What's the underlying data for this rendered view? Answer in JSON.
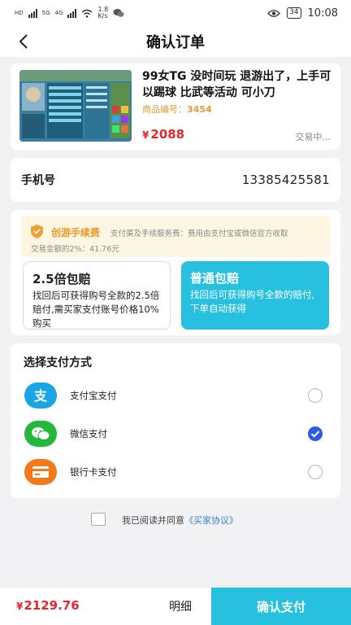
{
  "status_bar": {
    "network_left": "HD",
    "network_5g": "5G",
    "network_4g": "4G",
    "speed_value": "1.8",
    "speed_unit": "K/s",
    "battery": "34",
    "time": "10:08"
  },
  "header": {
    "title": "确认订单"
  },
  "product": {
    "title": "99女TG 没时间玩 退游出了，上手可以踢球 比武等活动 可小刀",
    "code_label": "商品编号：",
    "code_value": "3454",
    "currency": "¥",
    "price": "2088",
    "status": "交易中..."
  },
  "phone": {
    "label": "手机号",
    "value": "13385425581"
  },
  "fee": {
    "title": "创游手续费",
    "desc_line1": "支付渠及手续服务费：费用由支付宝或微信官方收取",
    "desc_line2": "交易金额的2%：41.76元"
  },
  "compensation_options": [
    {
      "title": "2.5倍包赔",
      "desc": "找回后可获得购号全款的2.5倍赔付,需买家支付账号价格10%购买",
      "selected": false
    },
    {
      "title": "普通包赔",
      "desc": "找回后可获得购号全款的赔付,下单自动获得",
      "selected": true
    }
  ],
  "payment": {
    "heading": "选择支付方式",
    "methods": [
      {
        "label": "支付宝支付",
        "icon": "alipay-icon",
        "color": "#1aa6e4",
        "selected": false
      },
      {
        "label": "微信支付",
        "icon": "wechat-icon",
        "color": "#22b83a",
        "selected": true
      },
      {
        "label": "银行卡支付",
        "icon": "bank-card-icon",
        "color": "#f27a1a",
        "selected": false
      }
    ]
  },
  "agreement": {
    "text": "我已阅读并同意",
    "link": "《买家协议》",
    "checked": false
  },
  "bottom": {
    "currency": "¥",
    "total": "2129.76",
    "detail_label": "明细",
    "confirm_label": "确认支付"
  },
  "colors": {
    "accent": "#27c0df",
    "price": "#e0282e",
    "fee": "#e99a2c",
    "radio_selected": "#2b5be0"
  }
}
